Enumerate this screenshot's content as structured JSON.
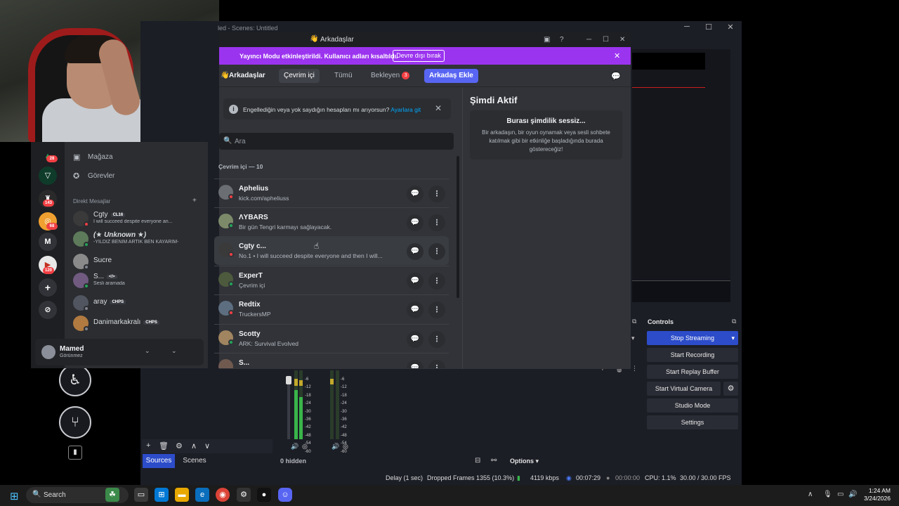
{
  "obs": {
    "title": "led - Scenes: Untitled",
    "sources_tab": "Sources",
    "scenes_tab": "Scenes",
    "mixer_hidden": "0 hidden",
    "mixer_options": "Options",
    "db_scale": [
      "-6",
      "-12",
      "-18",
      "-24",
      "-30",
      "-36",
      "-42",
      "-48",
      "-54",
      "-60"
    ],
    "controls": {
      "title": "Controls",
      "stop_streaming": "Stop Streaming",
      "start_recording": "Start Recording",
      "start_replay": "Start Replay Buffer",
      "start_virtual_cam": "Start Virtual Camera",
      "studio_mode": "Studio Mode",
      "settings": "Settings"
    },
    "status": {
      "delay": "Delay (1 sec)",
      "dropped": "Dropped Frames 1355 (10.3%)",
      "kbps": "4119 kbps",
      "stream_time": "00:07:29",
      "rec_time": "00:00:00",
      "cpu": "CPU: 1.1%",
      "fps": "30.00 / 30.00 FPS"
    }
  },
  "discord": {
    "window_title": "Arkadaşlar",
    "streamer_mode": {
      "text": "Yayıncı Modu etkinleştirildi. Kullanıcı adları kısaltıldı.",
      "button": "Devre dışı bırak"
    },
    "header": {
      "title": "Arkadaşlar",
      "tabs": [
        {
          "label": "Çevrim içi"
        },
        {
          "label": "Tümü"
        },
        {
          "label": "Bekleyen",
          "badge": "3"
        },
        {
          "label": "Arkadaş Ekle"
        }
      ]
    },
    "notice": {
      "text": "Engellediğin veya yok saydığın hesapları mı arıyorsun?",
      "link": "Ayarlara git"
    },
    "search_placeholder": "Ara",
    "online_count": "Çevrim içi — 10",
    "friends": [
      {
        "name": "Aphelius",
        "status": "kick.com/apheliuss",
        "color": "#6b6e73",
        "dot": "#f23f43"
      },
      {
        "name": "ΛYBARS",
        "status": "Bir gün Tengri karmayı sağlayacak.",
        "color": "#7d8a6a",
        "dot": "#23a55a"
      },
      {
        "name": "Cgty c...",
        "status": "No.1 • I will succeed despite everyone and then I will...",
        "color": "#3a3a3a",
        "dot": "#f23f43"
      },
      {
        "name": "ExperT",
        "status": "Çevrim içi",
        "color": "#4d5a3d",
        "dot": "#23a55a"
      },
      {
        "name": "Redtix",
        "status": "TruckersMP",
        "color": "#5d6e80",
        "dot": "#f23f43"
      },
      {
        "name": "Scotty",
        "status": "ARK: Survival Evolved",
        "color": "#a08560",
        "dot": "#23a55a"
      },
      {
        "name": "S...",
        "status": "",
        "color": "#705a50",
        "dot": "#23a55a"
      }
    ],
    "active_now": {
      "title": "Şimdi Aktif",
      "empty_title": "Burası şimdilik sessiz...",
      "empty_desc": "Bir arkadaşın, bir oyun oynamak veya sesli sohbete katılmak gibi bir etkinliğe başladığında burada göstereceğiz!"
    },
    "sidebar": {
      "nav": [
        {
          "label": "Mağaza"
        },
        {
          "label": "Görevler"
        }
      ],
      "dm_header": "Direkt Mesajlar",
      "dms": [
        {
          "name": "Cgty",
          "tag": "CL16",
          "activity": "I will succeed despite everyone an...",
          "color": "#3a3a3a",
          "dot": "#f23f43"
        },
        {
          "name": "(★ Unknown ★)",
          "tag": "",
          "activity": "-YILDIZ BENIM ARTIK BEN KAYARIM-",
          "color": "#5d7a5a",
          "dot": "#23a55a"
        },
        {
          "name": "Sucre",
          "tag": "",
          "activity": "",
          "color": "#8a8a8a",
          "dot": "#80848e"
        },
        {
          "name": "S...",
          "tag": "</>",
          "activity": "Sesli aramada",
          "color": "#705a80",
          "dot": "#23a55a"
        },
        {
          "name": "aray",
          "tag": "CHPS",
          "activity": "",
          "color": "#505560",
          "dot": "#80848e"
        },
        {
          "name": "Danimarkakralı",
          "tag": "CHPS",
          "activity": "",
          "color": "#b07a40",
          "dot": "#80848e"
        }
      ],
      "guild_badges": [
        "28",
        "143",
        "68",
        "120"
      ],
      "guild_m": "M"
    },
    "user": {
      "name": "Mamed",
      "status": "Görünmez"
    }
  },
  "taskbar": {
    "search": "Search",
    "time": "1:24 AM",
    "date": "3/24/2026"
  }
}
